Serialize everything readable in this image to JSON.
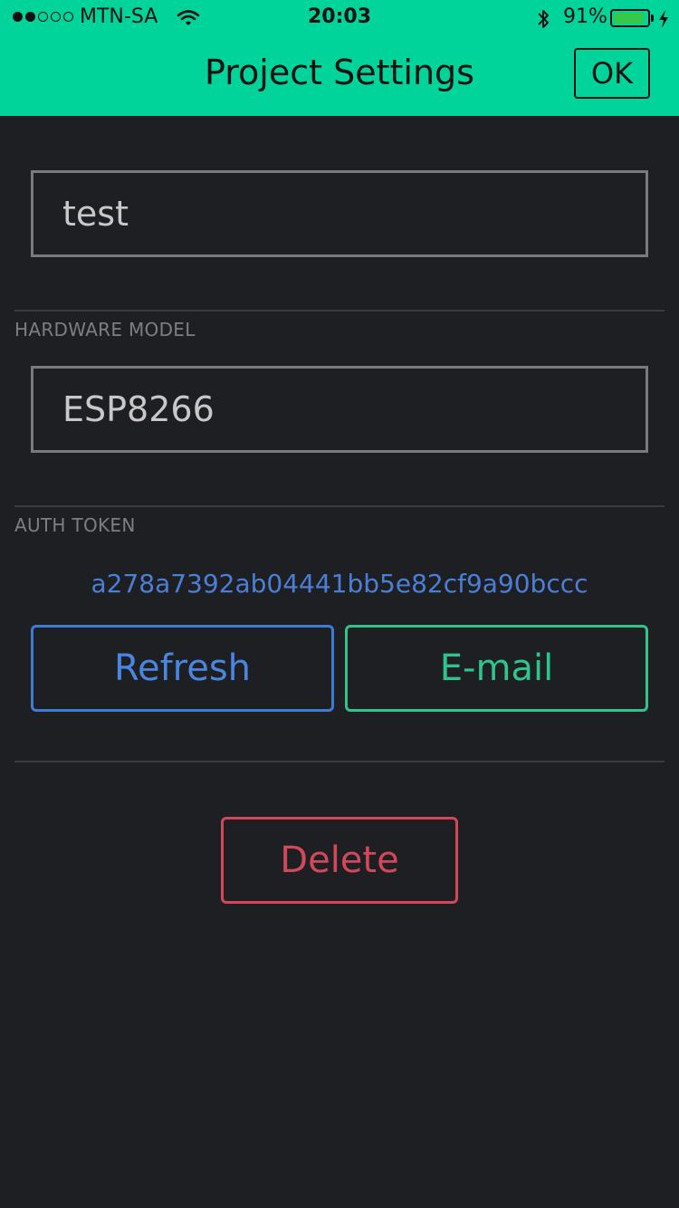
{
  "status_bar": {
    "carrier": "MTN-SA",
    "time": "20:03",
    "battery_percent_text": "91%",
    "battery_level": 0.91,
    "signal_bars_filled": 2,
    "signal_bars_total": 5,
    "icons": [
      "signal-dots-icon",
      "wifi-icon",
      "bluetooth-icon",
      "battery-icon",
      "charging-bolt-icon"
    ]
  },
  "header": {
    "title": "Project Settings",
    "ok_label": "OK"
  },
  "project": {
    "name_value": "test"
  },
  "hardware": {
    "label": "HARDWARE MODEL",
    "value": "ESP8266"
  },
  "auth": {
    "label": "AUTH TOKEN",
    "token": "a278a7392ab04441bb5e82cf9a90bccc",
    "refresh_label": "Refresh",
    "email_label": "E-mail"
  },
  "actions": {
    "delete_label": "Delete"
  },
  "colors": {
    "header_bg": "#00d49a",
    "background": "#1e1f23",
    "token_text": "#4a7fd8",
    "refresh": "#3f7bd6",
    "email": "#2ec48c",
    "delete": "#d2475a",
    "battery_fill": "#35c94c"
  }
}
